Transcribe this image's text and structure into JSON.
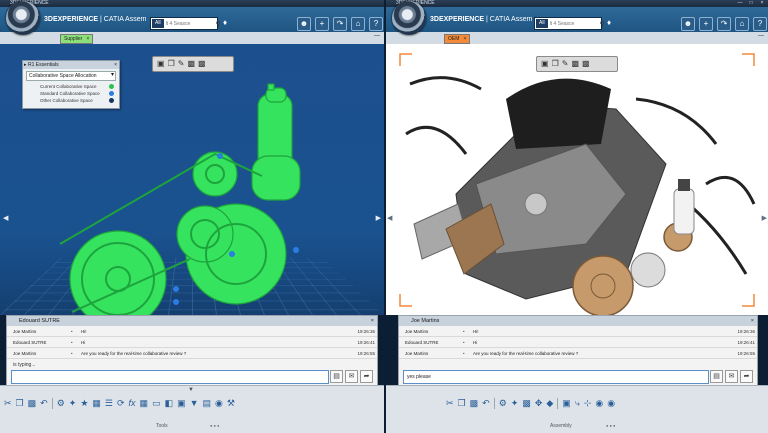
{
  "left": {
    "window_title": "3DEXPERIENCE",
    "brand_strong": "3DEXPERIENCE",
    "brand_rest": " | CATIA Assem",
    "search_scope": "All",
    "search_placeholder": "lt 4 Seasce",
    "tab_label": "Supplier",
    "panel": {
      "title": "R1 Essentials",
      "dropdown_value": "Collaborative Space Allocation",
      "items": [
        {
          "label": "Current Collaborative Space",
          "color": "#2fbf52"
        },
        {
          "label": "Standard Collaborative Space",
          "color": "#2a7de1"
        },
        {
          "label": "Other Collaborative Space",
          "color": "#14365e"
        }
      ]
    },
    "chat": {
      "header": "Edouard SUTRE",
      "rows": [
        {
          "sender": "Joe Martins",
          "text": "Hi!",
          "time": "19:26:36"
        },
        {
          "sender": "Edouard SUTRE",
          "text": "Hi",
          "time": "19:26:41"
        },
        {
          "sender": "Joe Martins",
          "text": "Are you ready for the real-time collaborative review ?",
          "time": "19:26:55"
        }
      ],
      "typing": "is typing...",
      "input_value": ""
    },
    "section_label": "Tools"
  },
  "right": {
    "window_title": "3DEXPERIENCE",
    "brand_strong": "3DEXPERIENCE",
    "brand_rest": " | CATIA Assem",
    "search_scope": "All",
    "search_placeholder": "lt 4 Seasce",
    "tab_label": "OEM",
    "chat": {
      "header": "Joe Martins",
      "rows": [
        {
          "sender": "Joe Martins",
          "text": "Hi!",
          "time": "19:26:36"
        },
        {
          "sender": "Edouard SUTRE",
          "text": "Hi",
          "time": "19:26:41"
        },
        {
          "sender": "Joe Martins",
          "text": "Are you ready for the real-time collaborative review ?",
          "time": "19:26:55"
        }
      ],
      "input_value": "yes please"
    },
    "section_label": "Assembly"
  },
  "colors": {
    "toolbar": "#2a6496",
    "viewport_left": "#1a528f",
    "model_green": "#2ee35a",
    "oem_tab": "#f28a3a",
    "supplier_tab": "#8be07a"
  }
}
